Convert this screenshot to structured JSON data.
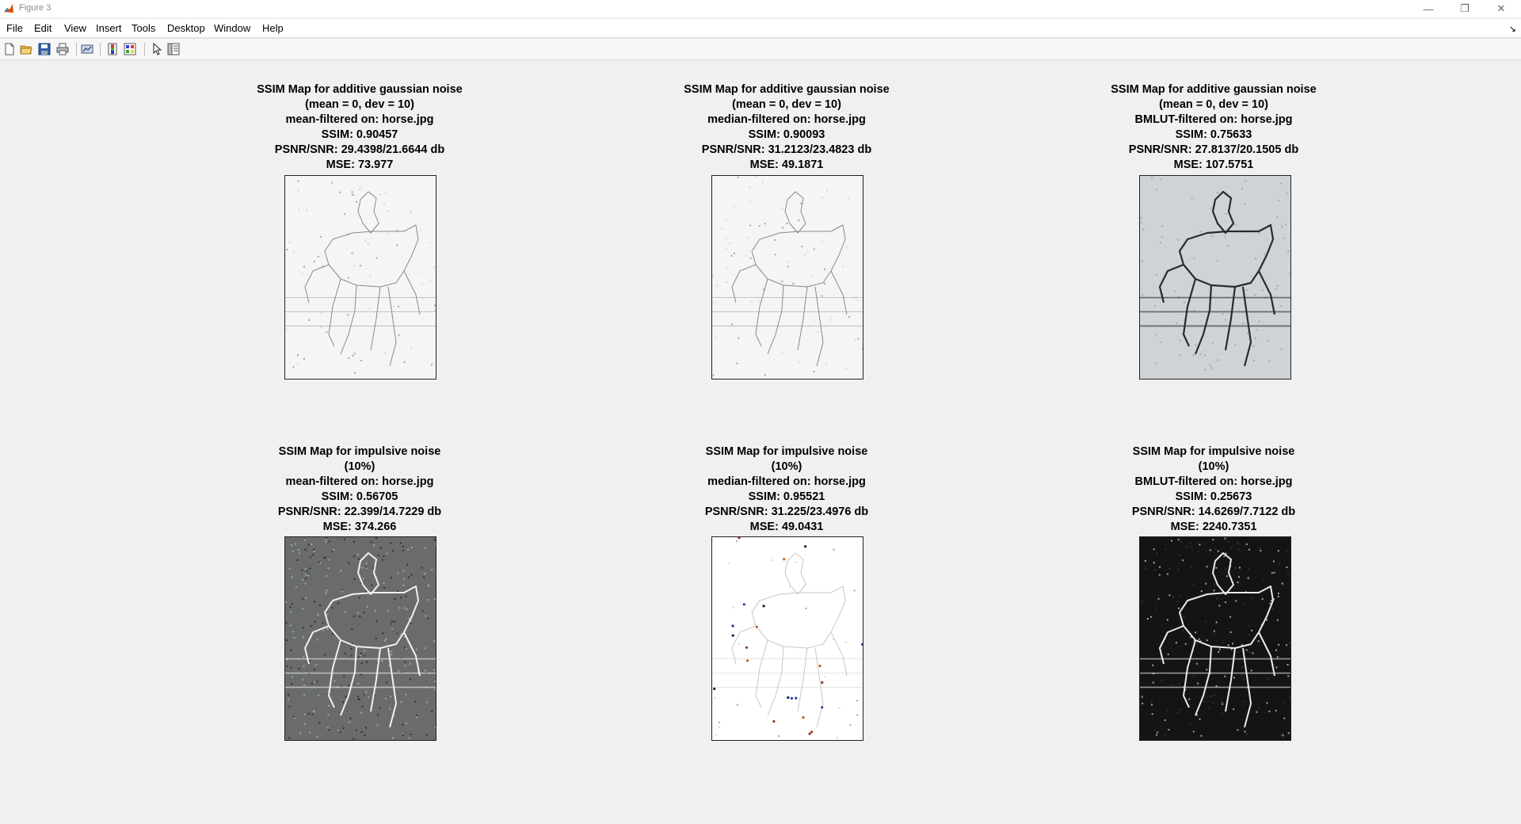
{
  "window": {
    "title": "Figure 3",
    "controls": [
      "—",
      "❐",
      "✕"
    ]
  },
  "menu": [
    "File",
    "Edit",
    "View",
    "Insert",
    "Tools",
    "Desktop",
    "Window",
    "Help"
  ],
  "toolbar": {
    "icons": [
      "new-figure-icon",
      "open-file-icon",
      "save-icon",
      "print-icon",
      "link-plot-icon",
      "colorbar-icon",
      "legend-icon",
      "edit-plot-icon",
      "property-inspector-icon"
    ]
  },
  "dock_arrow": "↘",
  "subplots": [
    {
      "lines": [
        "SSIM Map for additive gaussian noise",
        "(mean = 0, dev = 10)",
        "mean-filtered on: horse.jpg",
        "SSIM: 0.90457",
        "PSNR/SNR: 29.4398/21.6644 db",
        "MSE: 73.977"
      ],
      "map": {
        "style": "light"
      }
    },
    {
      "lines": [
        "SSIM Map for additive gaussian noise",
        "(mean = 0, dev = 10)",
        "median-filtered on: horse.jpg",
        "SSIM: 0.90093",
        "PSNR/SNR: 31.2123/23.4823 db",
        "MSE: 49.1871"
      ],
      "map": {
        "style": "light"
      }
    },
    {
      "lines": [
        "SSIM Map for additive gaussian noise",
        "(mean = 0, dev = 10)",
        "BMLUT-filtered on: horse.jpg",
        "SSIM: 0.75633",
        "PSNR/SNR: 27.8137/20.1505 db",
        "MSE: 107.5751"
      ],
      "map": {
        "style": "medium"
      }
    },
    {
      "lines": [
        "SSIM Map for impulsive noise",
        "(10%)",
        "mean-filtered on: horse.jpg",
        "SSIM: 0.56705",
        "PSNR/SNR: 22.399/14.7229 db",
        "MSE: 374.266"
      ],
      "map": {
        "style": "dark"
      }
    },
    {
      "lines": [
        "SSIM Map for impulsive noise",
        "(10%)",
        "median-filtered on: horse.jpg",
        "SSIM: 0.95521",
        "PSNR/SNR: 31.225/23.4976 db",
        "MSE: 49.0431"
      ],
      "map": {
        "style": "very-light"
      }
    },
    {
      "lines": [
        "SSIM Map for impulsive noise",
        "(10%)",
        "BMLUT-filtered on: horse.jpg",
        "SSIM: 0.25673",
        "PSNR/SNR: 14.6269/7.7122 db",
        "MSE: 2240.7351"
      ],
      "map": {
        "style": "very-dark"
      }
    }
  ]
}
